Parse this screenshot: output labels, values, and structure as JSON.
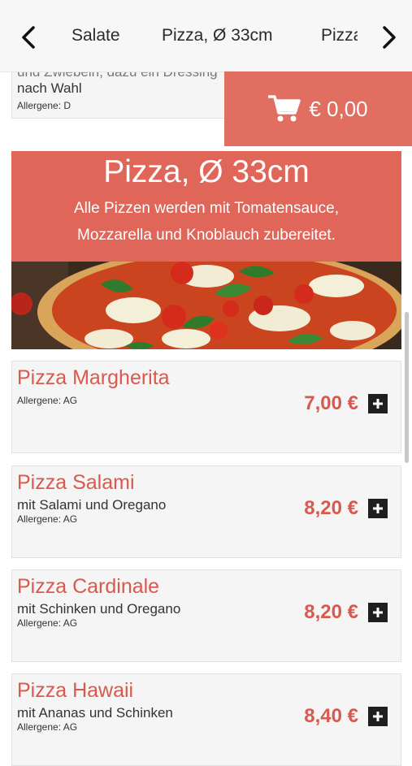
{
  "nav": {
    "tabs": [
      "Salate",
      "Pizza, Ø 33cm",
      "Pizza"
    ]
  },
  "cart": {
    "total": "€ 0,00"
  },
  "previous_item": {
    "description_partial": "und Zwiebeln, dazu ein Dressing",
    "description_end": "nach Wahl",
    "allergens": "Allergene: D"
  },
  "category": {
    "title": "Pizza, Ø 33cm",
    "description_line1": "Alle Pizzen werden mit Tomatensauce,",
    "description_line2": "Mozzarella und Knoblauch zubereitet."
  },
  "items": [
    {
      "name": "Pizza Margherita",
      "description": "",
      "allergens": "Allergene: AG",
      "price": "7,00 €"
    },
    {
      "name": "Pizza Salami",
      "description": "mit Salami und Oregano",
      "allergens": "Allergene: AG",
      "price": "8,20 €"
    },
    {
      "name": "Pizza Cardinale",
      "description": "mit Schinken und Oregano",
      "allergens": "Allergene: AG",
      "price": "8,20 €"
    },
    {
      "name": "Pizza Hawaii",
      "description": "mit Ananas und Schinken",
      "allergens": "Allergene: AG",
      "price": "8,40 €"
    }
  ],
  "colors": {
    "accent": "#e0665a",
    "price": "#d9594c",
    "cart": "#e06f62"
  }
}
